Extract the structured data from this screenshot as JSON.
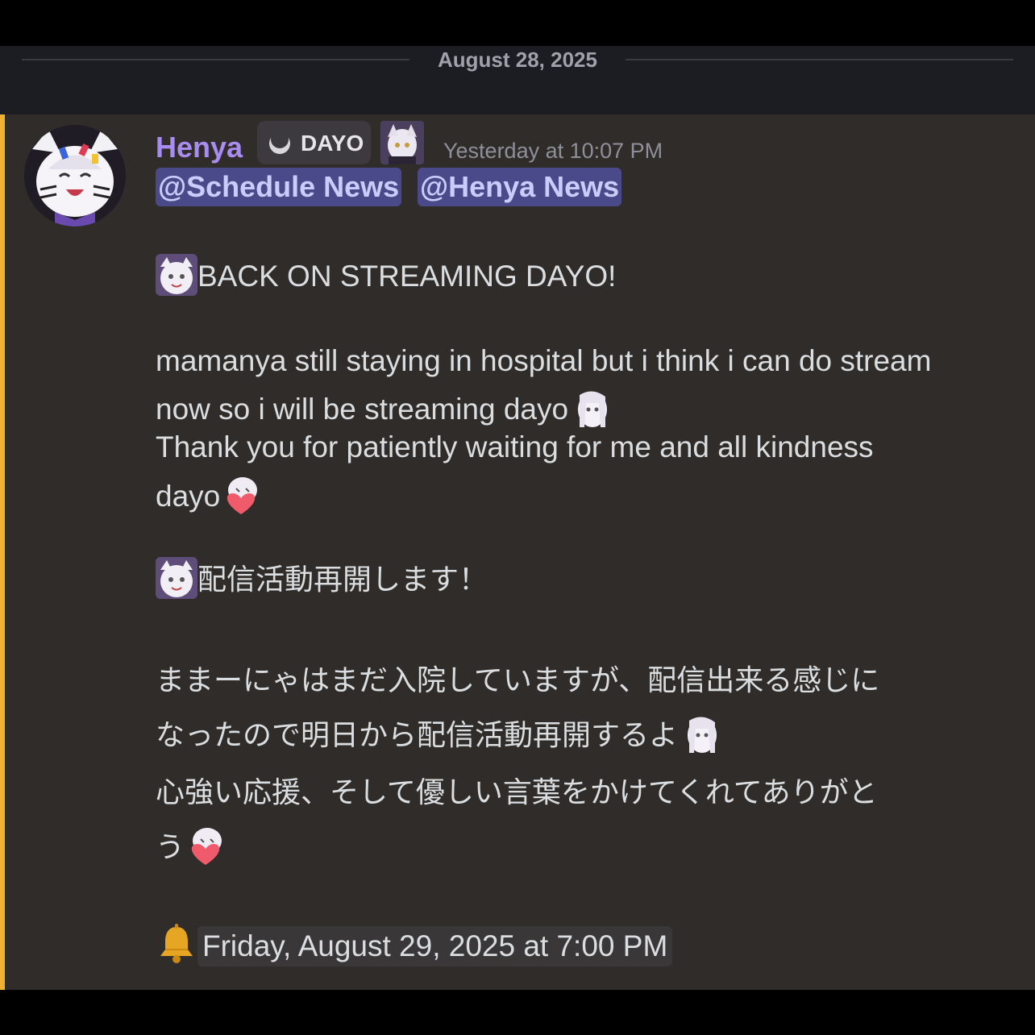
{
  "divider": {
    "date": "August 28, 2025"
  },
  "message": {
    "author": "Henya",
    "tag": "DAYO",
    "timestamp": "Yesterday at 10:07 PM",
    "mentions": [
      "@Schedule News",
      "@Henya News"
    ],
    "lines": {
      "en_heading": "BACK ON STREAMING DAYO!",
      "en_body_1": "mamanya still staying in hospital but i think i can do stream",
      "en_body_2": "now so i will be streaming dayo",
      "en_body_3": "Thank you for patiently waiting for me and all kindness",
      "en_body_4": "dayo",
      "jp_heading": "配信活動再開します！",
      "jp_body_1": "ままーにゃはまだ入院していますが、配信出来る感じに",
      "jp_body_2": "なったので明日から配信活動再開するよ",
      "jp_body_3": "心強い応援、そして優しい言葉をかけてくれてありがと",
      "jp_body_4": "う",
      "event_time": "Friday, August 29, 2025 at 7:00 PM"
    }
  },
  "icons": {
    "avatar": "avatar-henya",
    "tag_icon": "moon-icon",
    "role_icon": "role-henya-icon",
    "emoji_wave": "henya-emoji",
    "emoji_peek": "henya-peek-emoji",
    "emoji_heart": "henya-heart-emoji",
    "bell": "bell-icon"
  },
  "colors": {
    "accent": "#f0b232",
    "username": "#a88cf0",
    "mention_bg": "#4a4a8a",
    "mention_text": "#c9cdfb",
    "message_bg": "#302c29"
  }
}
